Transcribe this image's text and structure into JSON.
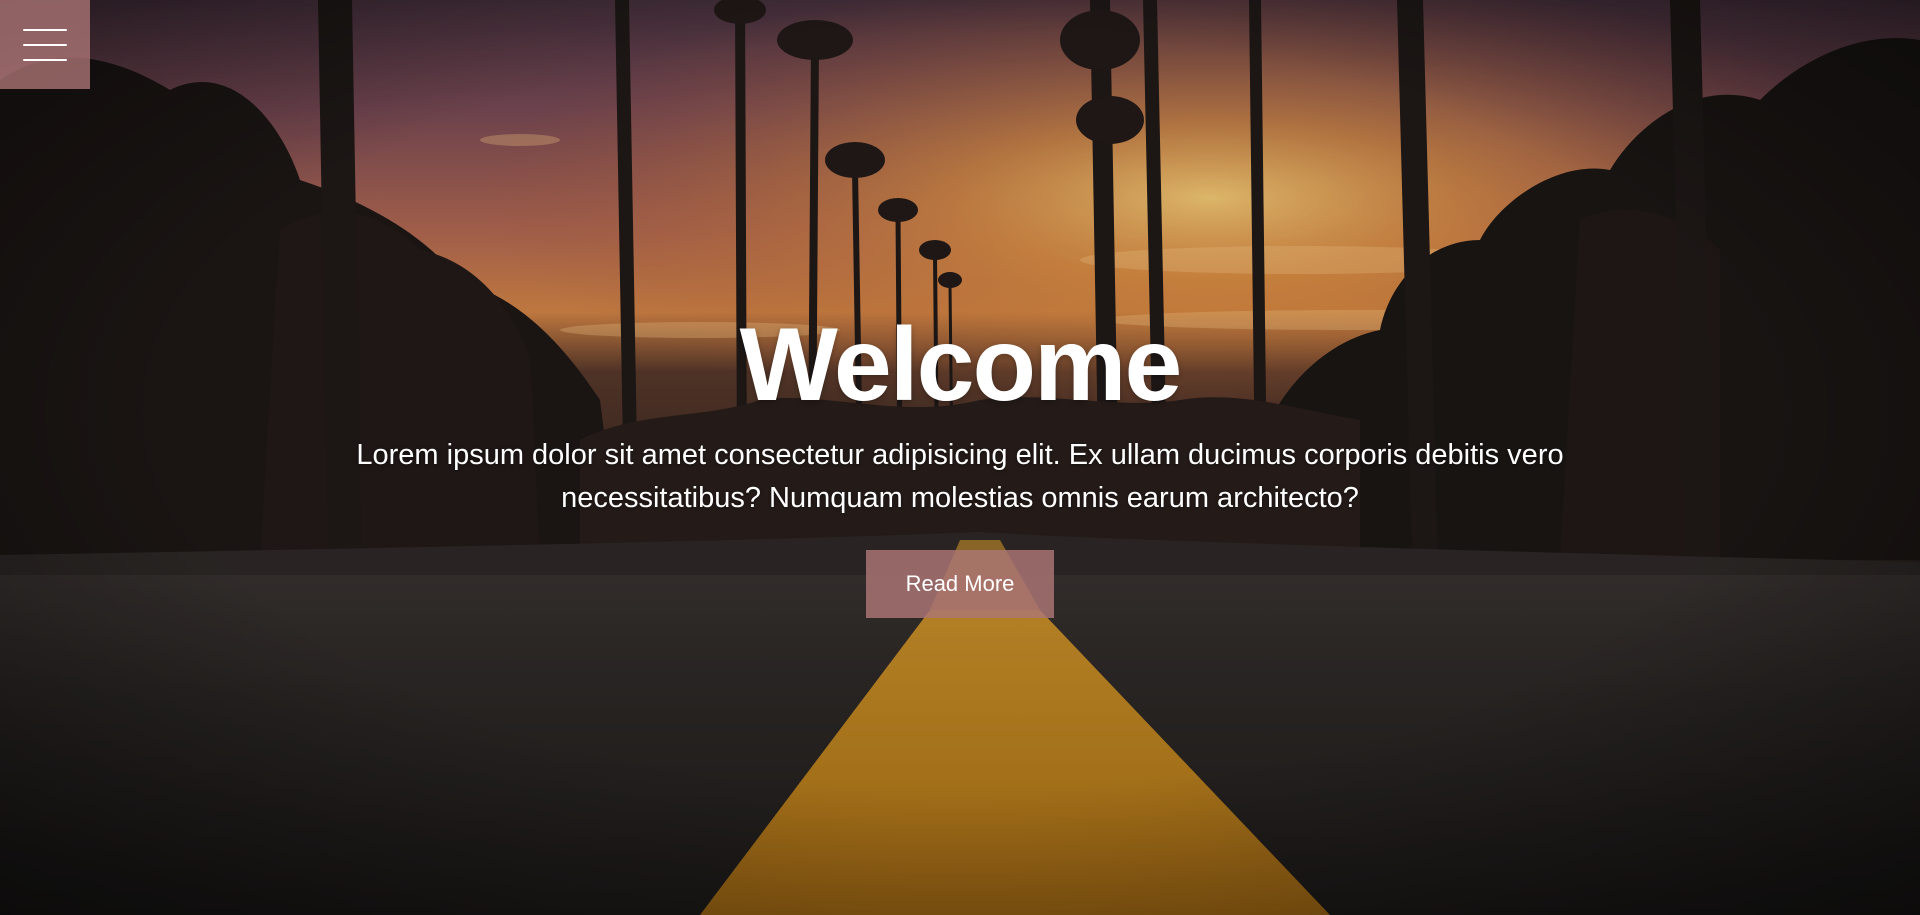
{
  "menu": {
    "icon": "hamburger-menu-icon"
  },
  "hero": {
    "background": "sunset-road-palm-trees-photo",
    "title": "Welcome",
    "text": "Lorem ipsum dolor sit amet consectetur adipisicing elit. Ex ullam ducimus corporis debitis vero necessitatibus? Numquam molestias omnis earum architecto?",
    "button_label": "Read More"
  },
  "colors": {
    "accent": "#ad7676",
    "text": "#ffffff"
  }
}
